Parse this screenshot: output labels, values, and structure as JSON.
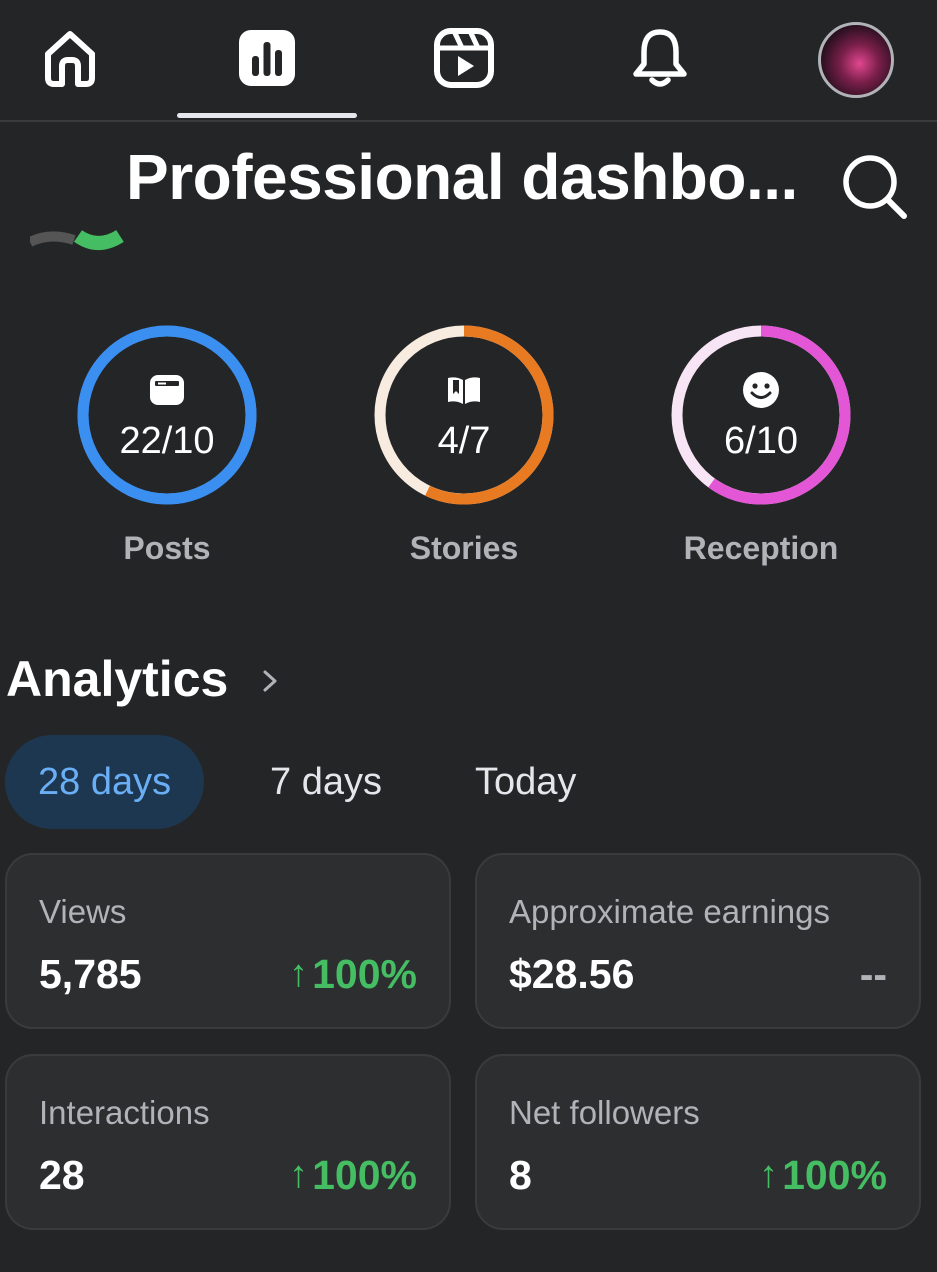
{
  "nav": {
    "items": [
      {
        "name": "home",
        "icon": "home-icon"
      },
      {
        "name": "dashboard",
        "icon": "bar-chart-icon",
        "active": true
      },
      {
        "name": "reels",
        "icon": "reels-icon"
      },
      {
        "name": "notifications",
        "icon": "bell-icon"
      },
      {
        "name": "profile",
        "icon": "avatar"
      }
    ]
  },
  "header": {
    "title": "Professional dashbo..."
  },
  "goals": [
    {
      "label": "Posts",
      "value": "22/10",
      "icon": "post-icon",
      "progress": 1.0,
      "color": "#3b8ff0",
      "track": "#3b8ff0"
    },
    {
      "label": "Stories",
      "value": "4/7",
      "icon": "book-icon",
      "progress": 0.5714,
      "color": "#e87a22",
      "track": "#f8ece0"
    },
    {
      "label": "Reception",
      "value": "6/10",
      "icon": "smiley-icon",
      "progress": 0.6,
      "color": "#e356d6",
      "track": "#f7e4f5"
    }
  ],
  "analytics": {
    "title": "Analytics",
    "tabs": [
      "28 days",
      "7 days",
      "Today"
    ],
    "active_tab": "28 days",
    "cards": [
      {
        "label": "Views",
        "value": "5,785",
        "arrow": "↑",
        "change": "100%"
      },
      {
        "label": "Approximate earnings",
        "value": "$28.56",
        "arrow": "",
        "change": "--"
      },
      {
        "label": "Interactions",
        "value": "28",
        "arrow": "↑",
        "change": "100%"
      },
      {
        "label": "Net followers",
        "value": "8",
        "arrow": "↑",
        "change": "100%"
      }
    ]
  },
  "colors": {
    "background": "#242526",
    "positive": "#45bd62",
    "active_tab_bg": "#1e3750",
    "active_tab_text": "#6aaef5"
  }
}
